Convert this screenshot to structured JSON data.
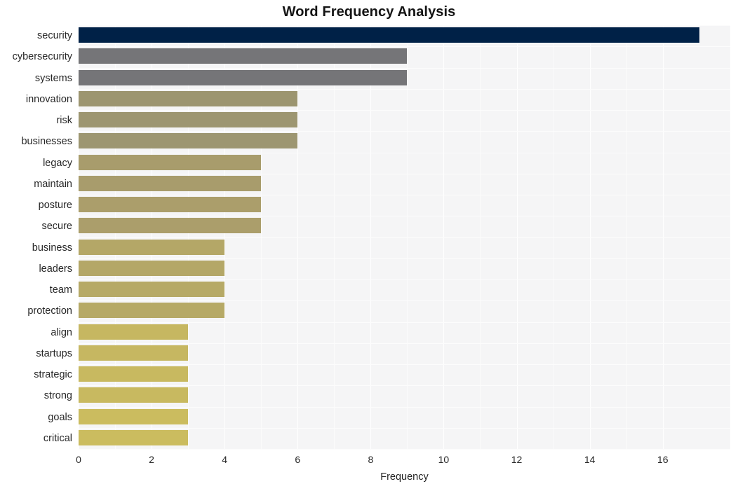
{
  "chart_data": {
    "type": "bar",
    "orientation": "horizontal",
    "title": "Word Frequency Analysis",
    "xlabel": "Frequency",
    "ylabel": "",
    "xlim": [
      0,
      17.85
    ],
    "xticks": [
      0,
      2,
      4,
      6,
      8,
      10,
      12,
      14,
      16
    ],
    "xticklabels": [
      "0",
      "2",
      "4",
      "6",
      "8",
      "10",
      "12",
      "14",
      "16"
    ],
    "grid": true,
    "grid_axis": "x",
    "legend": null,
    "categories": [
      "security",
      "cybersecurity",
      "systems",
      "innovation",
      "risk",
      "businesses",
      "legacy",
      "maintain",
      "posture",
      "secure",
      "business",
      "leaders",
      "team",
      "protection",
      "align",
      "startups",
      "strategic",
      "strong",
      "goals",
      "critical"
    ],
    "values": [
      17,
      9,
      9,
      6,
      6,
      6,
      5,
      5,
      5,
      5,
      4,
      4,
      4,
      4,
      3,
      3,
      3,
      3,
      3,
      3
    ],
    "bar_colors": [
      "#002147",
      "#757578",
      "#757578",
      "#9c9570",
      "#9d9671",
      "#9d9671",
      "#a89c6c",
      "#a89c6c",
      "#ab9e6b",
      "#ab9e6b",
      "#b4a767",
      "#b4a767",
      "#b6a966",
      "#b6a966",
      "#c6b761",
      "#c6b761",
      "#c8b960",
      "#c8b960",
      "#cbbc5f",
      "#cbbc5f"
    ],
    "plot_background": "#f5f5f6",
    "gridline_color": "#ffffff",
    "figure_background": "#ffffff"
  }
}
